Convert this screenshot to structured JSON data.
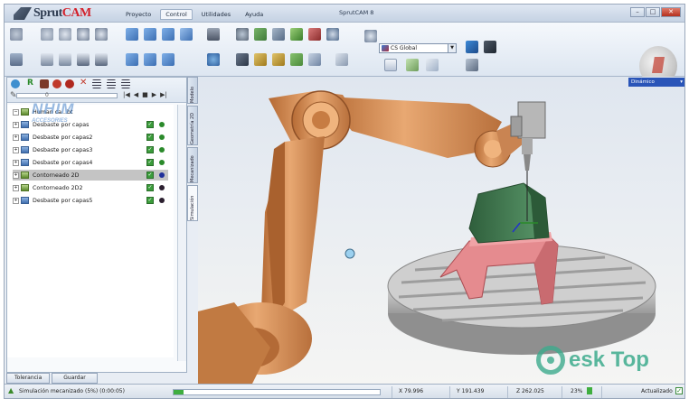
{
  "app": {
    "logo_prefix": "Sprut",
    "logo_suffix": "CAM",
    "window_title": "SprutCAM 8",
    "menu_tabs": [
      "Proyecto",
      "Control",
      "Utilidades",
      "Ayuda"
    ],
    "active_tab": "Control"
  },
  "ribbon": {
    "cs_select_value": "CS Global"
  },
  "left_panel": {
    "slider_value": "0",
    "tree": [
      {
        "label": "Human   ca   ..bt",
        "selected": false
      },
      {
        "label": "Desbaste por capas",
        "selected": false
      },
      {
        "label": "Desbaste por capas2",
        "selected": false
      },
      {
        "label": "Desbaste por capas3",
        "selected": false
      },
      {
        "label": "Desbaste por capas4",
        "selected": false
      },
      {
        "label": "Contorneado 2D",
        "selected": true
      },
      {
        "label": "Contorneado 2D2",
        "selected": false
      },
      {
        "label": "Desbaste por capas5",
        "selected": false
      }
    ],
    "vertical_tabs": [
      "Modelo",
      "Geometría 2D",
      "Mecanizado",
      "Simulación"
    ],
    "buttons": [
      "Tolerancia",
      "Guardar"
    ],
    "overlay_watermark": "NHIM",
    "overlay_watermark_sub": "ACCESORIES"
  },
  "viewport": {
    "view_mode": "Dinámico"
  },
  "status": {
    "message": "Simulación mecanizado (5%) (0:00:05)",
    "progress_pct": 5,
    "x": "X 79.996",
    "y": "Y 191.439",
    "z": "Z 262.025",
    "zoom": "23%",
    "state": "Actualizado"
  },
  "watermark": {
    "text": "esk Top"
  },
  "colors": {
    "robot": "#d9925a",
    "table": "#b9b9b9",
    "fixture": "#e58b8f",
    "workpiece": "#3f7a4f",
    "accent_red": "#d3202a"
  }
}
